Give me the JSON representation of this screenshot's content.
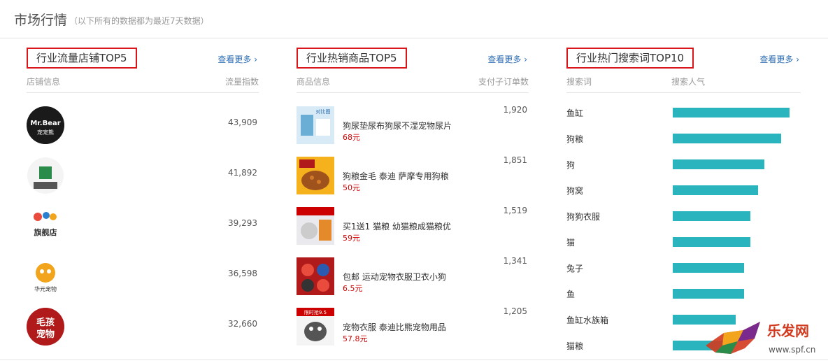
{
  "header": {
    "title": "市场行情",
    "subtitle": "（以下所有的数据都为最近7天数据）"
  },
  "shops": {
    "title": "行业流量店铺TOP5",
    "more": "查看更多 ›",
    "col_left": "店铺信息",
    "col_right": "流量指数",
    "items": [
      {
        "name": "",
        "value": "43,909",
        "logo_text": "Mr.Bear",
        "logo_sub": "宠宠熊",
        "logo_bg": "#1a1a1a"
      },
      {
        "name": "",
        "value": "41,892",
        "logo_text": "",
        "logo_sub": "",
        "logo_bg": "#ffffff"
      },
      {
        "name": "",
        "value": "39,293",
        "logo_text": "旗舰店",
        "logo_sub": "",
        "logo_bg": "#ffffff"
      },
      {
        "name": "",
        "value": "36,598",
        "logo_text": "华元宠物",
        "logo_sub": "",
        "logo_bg": "#ffffff"
      },
      {
        "name": "",
        "value": "32,660",
        "logo_text": "毛孩宠物",
        "logo_sub": "",
        "logo_bg": "#b11a1a"
      }
    ]
  },
  "products": {
    "title": "行业热销商品TOP5",
    "more": "查看更多 ›",
    "col_left": "商品信息",
    "col_right": "支付子订单数",
    "items": [
      {
        "name": "狗尿垫尿布狗尿不湿宠物尿片",
        "price": "68元",
        "value": "1,920",
        "img_label": "对比图"
      },
      {
        "name": "狗粮金毛 泰迪 萨摩专用狗粮",
        "price": "50元",
        "value": "1,851",
        "img_label": ""
      },
      {
        "name": "买1送1 猫粮 幼猫粮成猫粮优",
        "price": "59元",
        "value": "1,519",
        "img_label": ""
      },
      {
        "name": "包邮 运动宠物衣服卫衣小狗",
        "price": "6.5元",
        "value": "1,341",
        "img_label": ""
      },
      {
        "name": "宠物衣服 泰迪比熊宠物用品",
        "price": "57.8元",
        "value": "1,205",
        "img_label": "限时抢9.5"
      }
    ]
  },
  "keywords": {
    "title": "行业热门搜索词TOP10",
    "more": "查看更多 ›",
    "col_left": "搜索词",
    "col_right": "搜索人气",
    "bar_color": "#2ab5be",
    "items": [
      {
        "name": "鱼缸",
        "level": 0.98
      },
      {
        "name": "狗粮",
        "level": 0.91
      },
      {
        "name": "狗",
        "level": 0.77
      },
      {
        "name": "狗窝",
        "level": 0.72
      },
      {
        "name": "狗狗衣服",
        "level": 0.65
      },
      {
        "name": "猫",
        "level": 0.65
      },
      {
        "name": "兔子",
        "level": 0.6
      },
      {
        "name": "鱼",
        "level": 0.6
      },
      {
        "name": "鱼缸水族箱",
        "level": 0.53
      },
      {
        "name": "猫粮",
        "level": 0.47
      }
    ]
  },
  "watermark": {
    "brand": "乐发网",
    "url": "www.spf.cn"
  }
}
